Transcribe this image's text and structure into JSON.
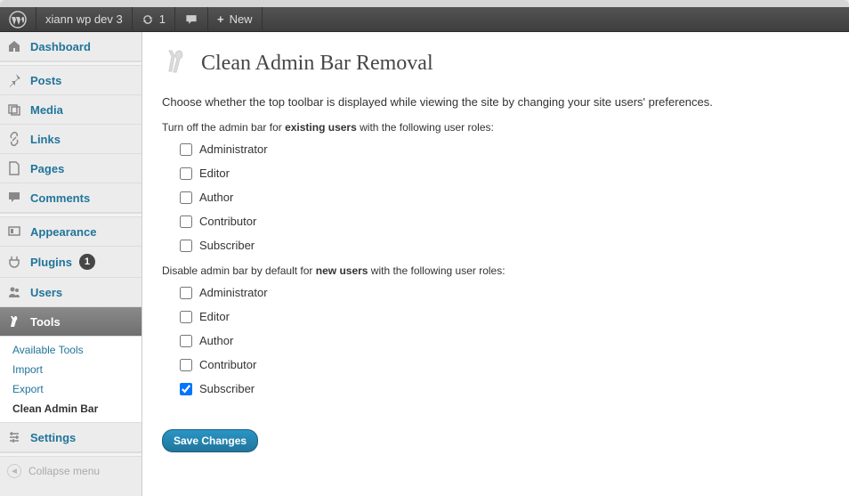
{
  "adminbar": {
    "site_name": "xiann wp dev 3",
    "refresh_count": "1",
    "new_label": "New"
  },
  "sidebar": {
    "dashboard": "Dashboard",
    "posts": "Posts",
    "media": "Media",
    "links": "Links",
    "pages": "Pages",
    "comments": "Comments",
    "appearance": "Appearance",
    "plugins": "Plugins",
    "plugins_count": "1",
    "users": "Users",
    "tools": "Tools",
    "tools_sub": {
      "available": "Available Tools",
      "import": "Import",
      "export": "Export",
      "clean": "Clean Admin Bar"
    },
    "settings": "Settings",
    "collapse": "Collapse menu"
  },
  "page": {
    "title": "Clean Admin Bar Removal",
    "intro": "Choose whether the top toolbar is displayed while viewing the site by changing your site users' preferences.",
    "section1_prefix": "Turn off the admin bar for ",
    "section1_strong": "existing users",
    "section1_suffix": " with the following user roles:",
    "section2_prefix": "Disable admin bar by default for ",
    "section2_strong": "new users",
    "section2_suffix": " with the following user roles:",
    "roles": {
      "administrator": "Administrator",
      "editor": "Editor",
      "author": "Author",
      "contributor": "Contributor",
      "subscriber": "Subscriber"
    },
    "checked": {
      "existing": {
        "administrator": false,
        "editor": false,
        "author": false,
        "contributor": false,
        "subscriber": false
      },
      "new": {
        "administrator": false,
        "editor": false,
        "author": false,
        "contributor": false,
        "subscriber": true
      }
    },
    "save_label": "Save Changes"
  }
}
